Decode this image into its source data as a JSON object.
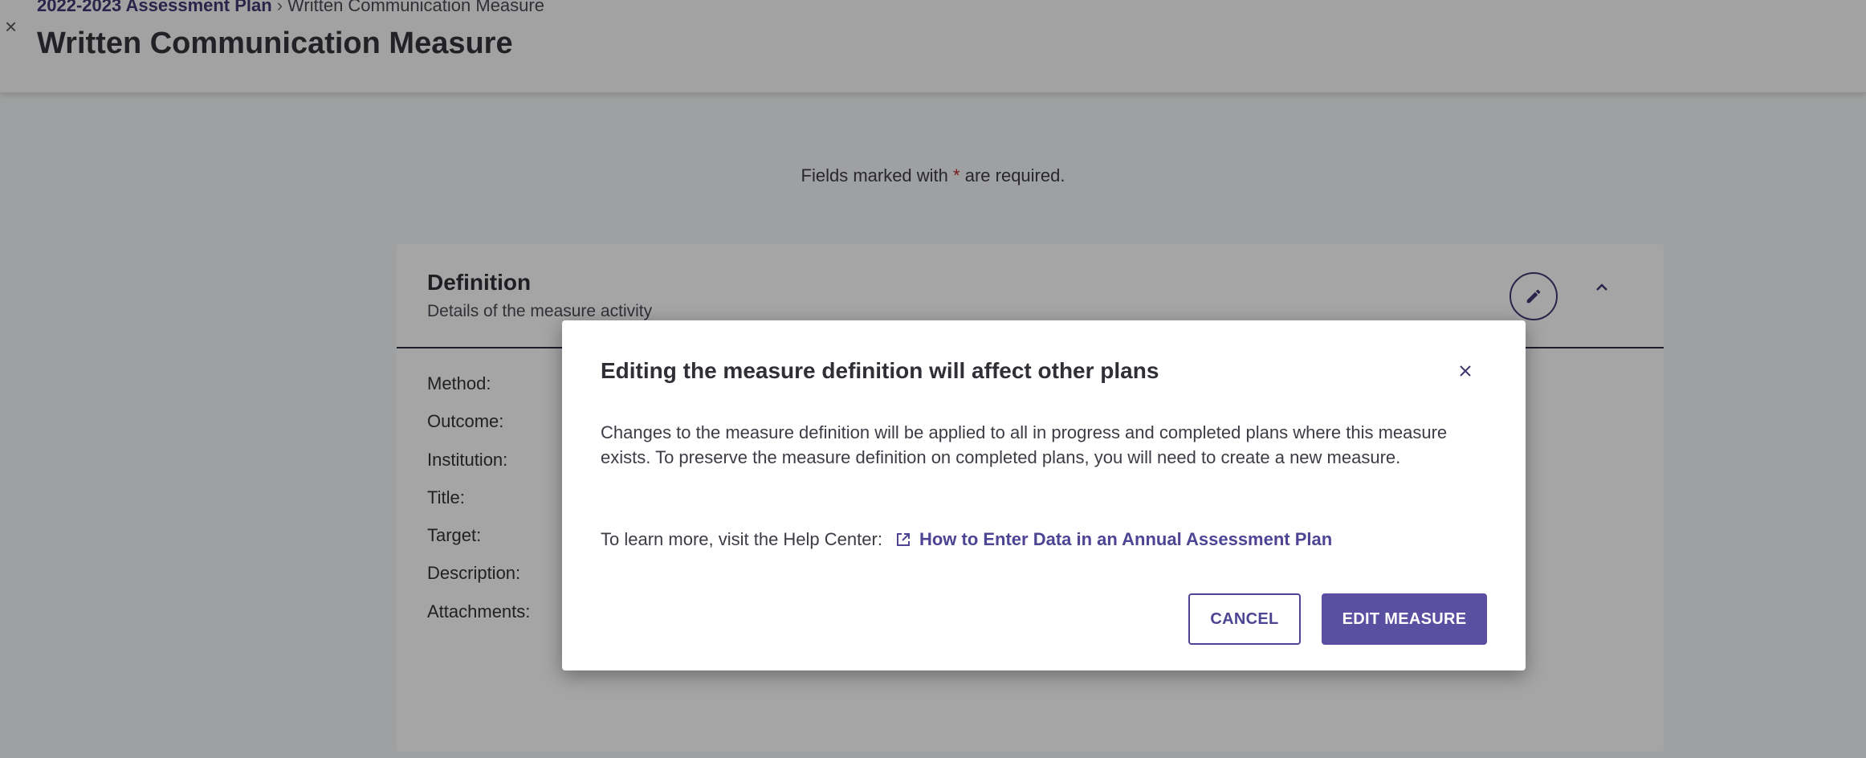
{
  "header": {
    "close_icon": "close-icon",
    "breadcrumb": {
      "parent": "2022-2023 Assessment Plan",
      "separator": "›",
      "current": "Written Communication Measure"
    },
    "title": "Written Communication Measure"
  },
  "required_note": {
    "prefix": "Fields marked with",
    "star": "*",
    "suffix": "are required."
  },
  "definition_card": {
    "title": "Definition",
    "subtitle": "Details of the measure activity",
    "edit_icon": "pencil-icon",
    "collapse_icon": "chevron-up-icon",
    "fields": [
      "Method:",
      "Outcome:",
      "Institution:",
      "Title:",
      "Target:",
      "Description:",
      "Attachments:"
    ]
  },
  "modal": {
    "title": "Editing the measure definition will affect other plans",
    "body": "Changes to the measure definition will be applied to all in progress and completed plans where this measure exists. To preserve the measure definition on completed plans, you will need to create a new measure.",
    "help_prefix": "To learn more, visit the Help Center:",
    "help_link": "How to Enter Data in an Annual Assessment Plan",
    "cancel_label": "CANCEL",
    "confirm_label": "EDIT MEASURE"
  },
  "colors": {
    "accent": "#5a4fa0",
    "link": "#4d4494",
    "required_star": "#b22b2b",
    "overlay": "rgba(0,0,0,0.34)"
  }
}
